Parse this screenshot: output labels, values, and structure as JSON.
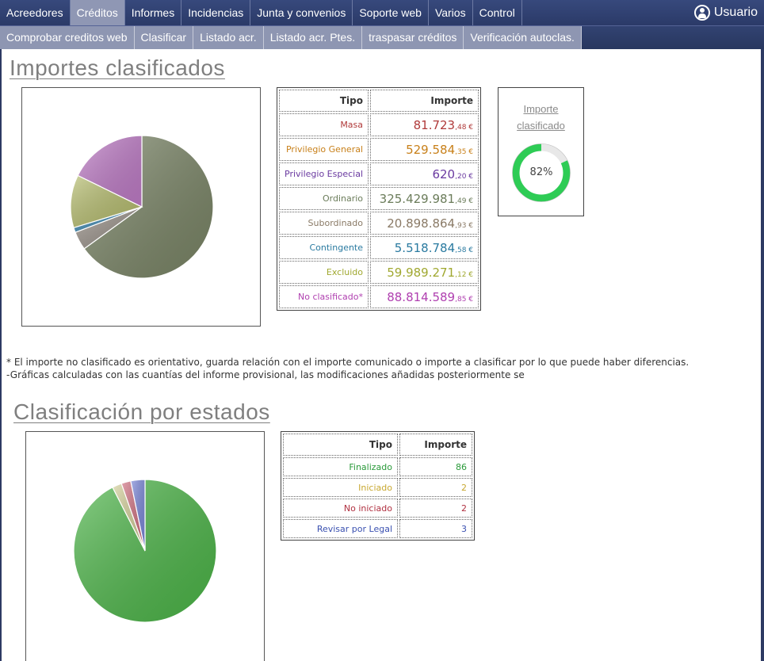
{
  "nav": {
    "top": [
      "Acreedores",
      "Créditos",
      "Informes",
      "Incidencias",
      "Junta y convenios",
      "Soporte web",
      "Varios",
      "Control"
    ],
    "active_index": 1,
    "user_label": "Usuario",
    "sub": [
      "Comprobar creditos web",
      "Clasificar",
      "Listado acr.",
      "Listado acr. Ptes.",
      "traspasar créditos",
      "Verificación autoclas."
    ]
  },
  "section1": {
    "title": "Importes clasificados",
    "table_headers": {
      "tipo": "Tipo",
      "importe": "Importe"
    },
    "rows": [
      {
        "label": "Masa",
        "whole": "81.723",
        "cents": ",48 €",
        "color": "#b03a3a"
      },
      {
        "label": "Privilegio General",
        "whole": "529.584",
        "cents": ",35 €",
        "color": "#c8801a"
      },
      {
        "label": "Privilegio Especial",
        "whole": "620",
        "cents": ",20 €",
        "color": "#6a3aa0"
      },
      {
        "label": "Ordinario",
        "whole": "325.429.981",
        "cents": ",49 €",
        "color": "#6b7c5a"
      },
      {
        "label": "Subordinado",
        "whole": "20.898.864",
        "cents": ",93 €",
        "color": "#8a7a66"
      },
      {
        "label": "Contingente",
        "whole": "5.518.784",
        "cents": ",58 €",
        "color": "#2a7aa0"
      },
      {
        "label": "Excluido",
        "whole": "59.989.271",
        "cents": ",12 €",
        "color": "#a0a830"
      },
      {
        "label": "No clasificado*",
        "whole": "88.814.589",
        "cents": ",85 €",
        "color": "#b040b0"
      }
    ],
    "donut": {
      "title": "Importe clasificado",
      "percent_label": "82%",
      "fraction": 0.82,
      "color": "#2ecc55",
      "track_color": "#e8e8e8"
    },
    "pie_colors": [
      "#7a8566",
      "#9a928a",
      "#3a86b0",
      "#b6bd6e",
      "#bf7cc7"
    ]
  },
  "notes": [
    "* El importe no clasificado es orientativo, guarda relación con el importe comunicado o importe a clasificar por lo que puede haber diferencias.",
    "-Gráficas calculadas con las cuantías del informe provisional, las modificaciones añadidas posteriormente se"
  ],
  "section2": {
    "title": "Clasificación por estados",
    "table_headers": {
      "tipo": "Tipo",
      "importe": "Importe"
    },
    "rows": [
      {
        "label": "Finalizado",
        "value": "86",
        "color": "#2a9a3a"
      },
      {
        "label": "Iniciado",
        "value": "2",
        "color": "#c8a830"
      },
      {
        "label": "No iniciado",
        "value": "2",
        "color": "#b03040"
      },
      {
        "label": "Revisar por Legal",
        "value": "3",
        "color": "#3a50b0"
      }
    ],
    "pie_colors": [
      "#4cb648",
      "#d4d09a",
      "#d07080",
      "#7a86d8"
    ]
  },
  "chart_data": [
    {
      "type": "pie",
      "categories": [
        "Ordinario",
        "Subordinado",
        "Contingente",
        "Excluido",
        "No clasificado*"
      ],
      "values": [
        325429981.49,
        20898864.93,
        5518784.58,
        59989271.12,
        88814589.85
      ]
    },
    {
      "type": "pie",
      "categories": [
        "Finalizado",
        "Iniciado",
        "No iniciado",
        "Revisar por Legal"
      ],
      "values": [
        86,
        2,
        2,
        3
      ]
    }
  ]
}
